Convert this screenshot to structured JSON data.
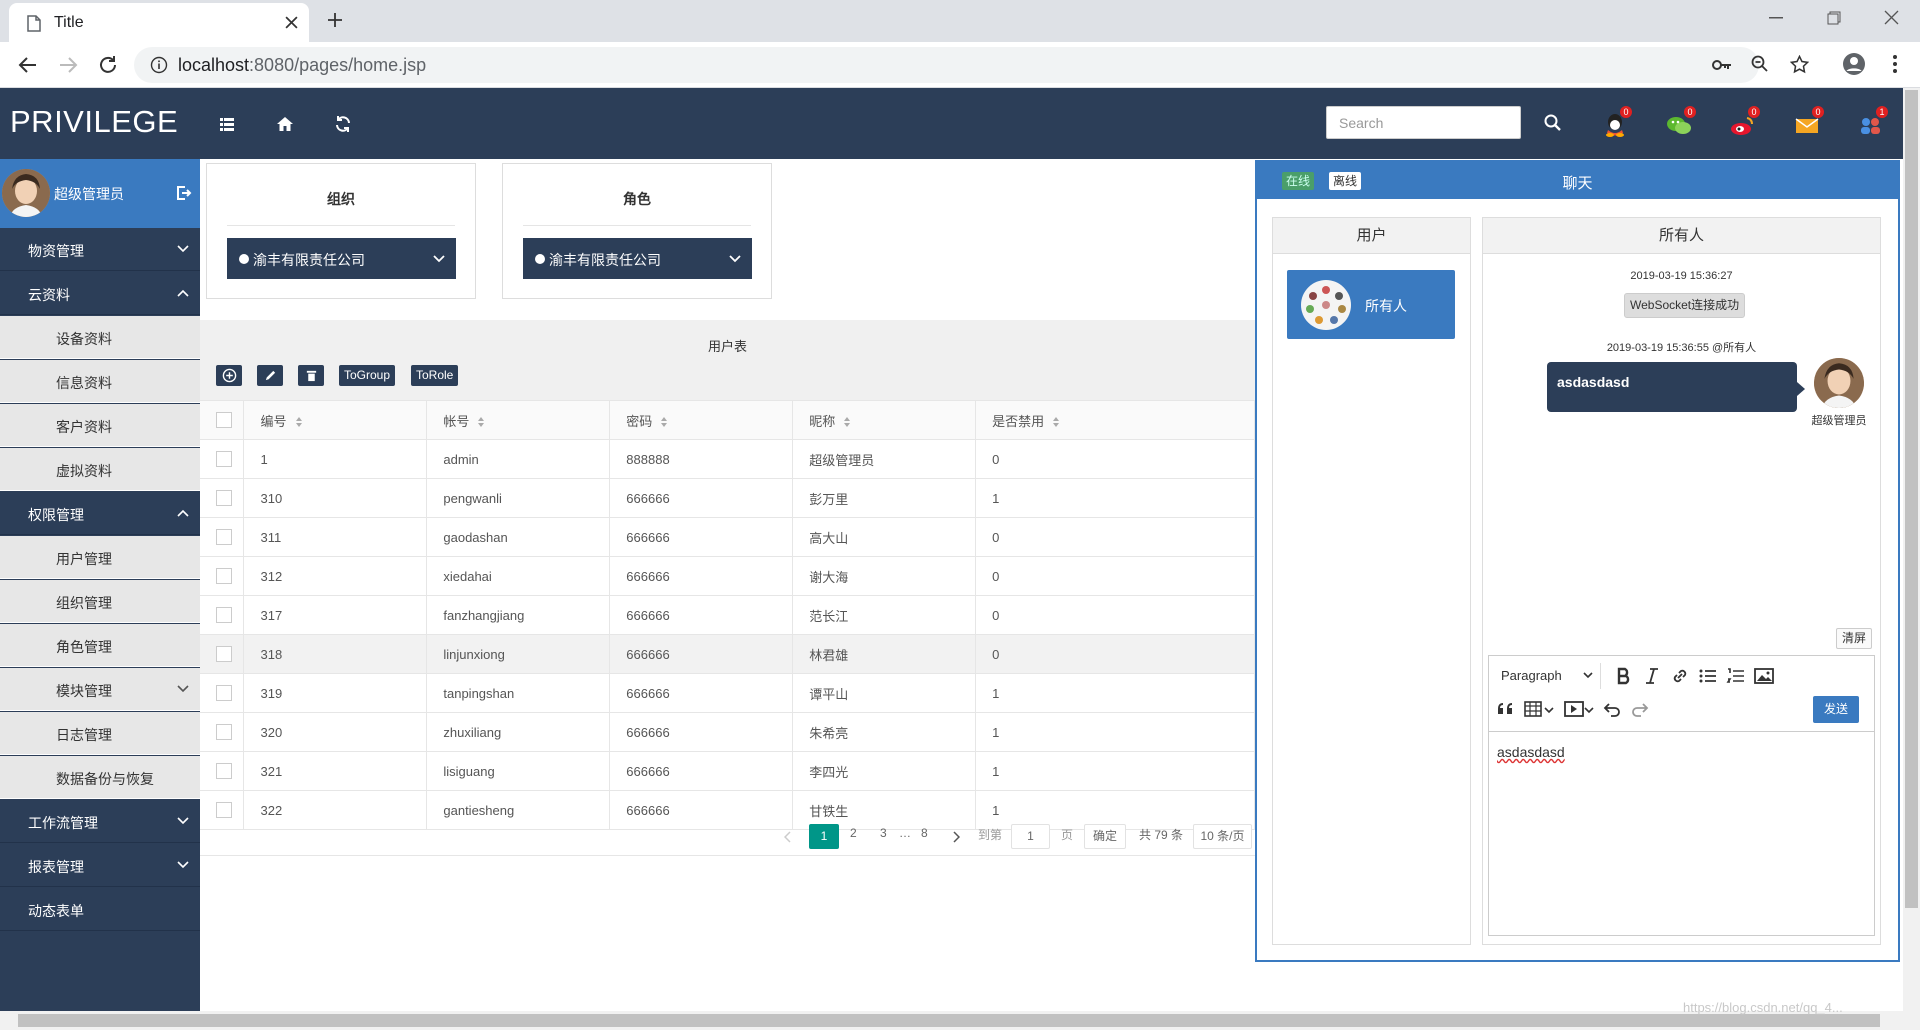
{
  "browser": {
    "tab_title": "Title",
    "url_host": "localhost",
    "url_path": ":8080/pages/home.jsp"
  },
  "header": {
    "logo": "PRIVILEGE",
    "search_placeholder": "Search",
    "notifications": [
      {
        "icon": "qq-icon",
        "count": "0"
      },
      {
        "icon": "wechat-icon",
        "count": "0"
      },
      {
        "icon": "weibo-icon",
        "count": "0"
      },
      {
        "icon": "mail-icon",
        "count": "0"
      },
      {
        "icon": "group-icon",
        "count": "1"
      }
    ]
  },
  "sidebar": {
    "user_name": "超级管理员",
    "items": [
      {
        "label": "物资管理",
        "type": "top",
        "chevron": "down"
      },
      {
        "label": "云资料",
        "type": "top",
        "chevron": "up"
      },
      {
        "label": "设备资料",
        "type": "sub"
      },
      {
        "label": "信息资料",
        "type": "sub"
      },
      {
        "label": "客户资料",
        "type": "sub"
      },
      {
        "label": "虚拟资料",
        "type": "sub"
      },
      {
        "label": "权限管理",
        "type": "top",
        "chevron": "up"
      },
      {
        "label": "用户管理",
        "type": "sub"
      },
      {
        "label": "组织管理",
        "type": "sub"
      },
      {
        "label": "角色管理",
        "type": "sub"
      },
      {
        "label": "模块管理",
        "type": "sub",
        "chevron": "down"
      },
      {
        "label": "日志管理",
        "type": "sub"
      },
      {
        "label": "数据备份与恢复",
        "type": "sub"
      },
      {
        "label": "工作流管理",
        "type": "top",
        "chevron": "down"
      },
      {
        "label": "报表管理",
        "type": "top",
        "chevron": "down"
      },
      {
        "label": "动态表单",
        "type": "top"
      }
    ]
  },
  "filters": {
    "org": {
      "title": "组织",
      "selected": "渝丰有限责任公司"
    },
    "role": {
      "title": "角色",
      "selected": "渝丰有限责任公司"
    }
  },
  "table": {
    "title": "用户表",
    "buttons": {
      "togroup": "ToGroup",
      "torole": "ToRole"
    },
    "columns": [
      "编号",
      "帐号",
      "密码",
      "昵称",
      "是否禁用"
    ],
    "rows": [
      [
        "1",
        "admin",
        "888888",
        "超级管理员",
        "0"
      ],
      [
        "310",
        "pengwanli",
        "666666",
        "彭万里",
        "1"
      ],
      [
        "311",
        "gaodashan",
        "666666",
        "高大山",
        "0"
      ],
      [
        "312",
        "xiedahai",
        "666666",
        "谢大海",
        "0"
      ],
      [
        "317",
        "fanzhangjiang",
        "666666",
        "范长江",
        "0"
      ],
      [
        "318",
        "linjunxiong",
        "666666",
        "林君雄",
        "0"
      ],
      [
        "319",
        "tanpingshan",
        "666666",
        "谭平山",
        "1"
      ],
      [
        "320",
        "zhuxiliang",
        "666666",
        "朱希亮",
        "1"
      ],
      [
        "321",
        "lisiguang",
        "666666",
        "李四光",
        "1"
      ],
      [
        "322",
        "gantiesheng",
        "666666",
        "甘铁生",
        "1"
      ]
    ],
    "pager": {
      "current": "1",
      "p2": "2",
      "p3": "3",
      "ellipsis": "…",
      "last": "8",
      "goto_label": "到第",
      "goto_value": "1",
      "page_unit": "页",
      "confirm": "确定",
      "total": "共 79 条",
      "per_page": "10 条/页"
    }
  },
  "chat": {
    "title": "聊天",
    "status_online": "在线",
    "status_offline": "离线",
    "users_header": "用户",
    "all_header": "所有人",
    "all_button": "所有人",
    "msg1_time": "2019-03-19 15:36:27",
    "msg1_text": "WebSocket连接成功",
    "msg2_time": "2019-03-19 15:36:55 @所有人",
    "msg2_text": "asdasdasd",
    "sender_name": "超级管理员",
    "clear_button": "清屏",
    "editor_format": "Paragraph",
    "send_button": "发送",
    "editor_text": "asdasdasd"
  },
  "watermark": "https://blog.csdn.net/qq_4..."
}
